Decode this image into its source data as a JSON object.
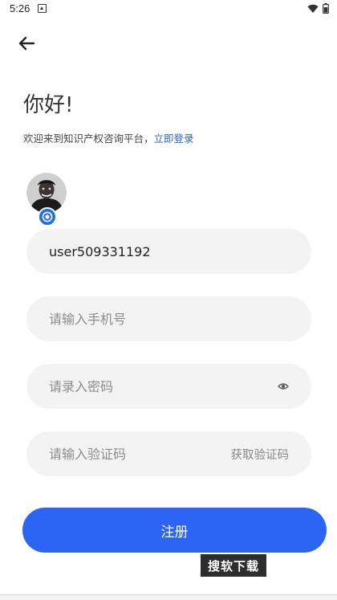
{
  "status_bar": {
    "time": "5:26"
  },
  "header": {
    "greeting": "你好!",
    "welcome_text": "欢迎来到知识产权咨询平台，",
    "login_link": "立即登录"
  },
  "form": {
    "username_value": "user509331192",
    "phone_placeholder": "请输入手机号",
    "password_placeholder": "请录入密码",
    "code_placeholder": "请输入验证码",
    "get_code_label": "获取验证码",
    "register_label": "注册"
  },
  "watermark": "搜软下载",
  "colors": {
    "accent": "#2c64f6",
    "link": "#2a62e8",
    "field_bg": "#f3f3f3"
  }
}
